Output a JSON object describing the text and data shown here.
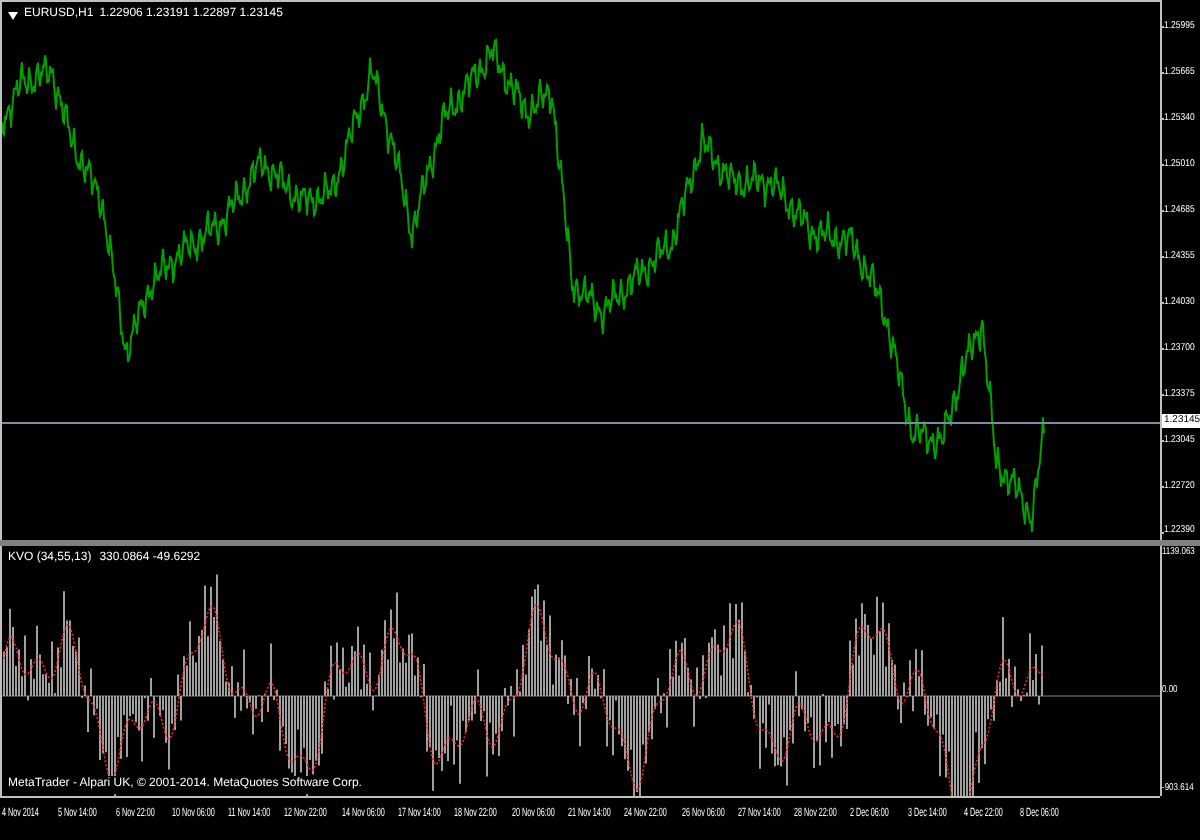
{
  "symbol_header": {
    "text": "EURUSD,H1",
    "quotes": "1.22906 1.23191 1.22897 1.23145"
  },
  "price_axis": {
    "ticks": [
      "1.25995",
      "1.25665",
      "1.25340",
      "1.25010",
      "1.24685",
      "1.24355",
      "1.24030",
      "1.23700",
      "1.23375",
      "1.23045",
      "1.22720",
      "1.22390"
    ],
    "current_price": "1.23145"
  },
  "indicator": {
    "label": "KVO (34,55,13)",
    "values": "330.0864 -49.6292",
    "axis": [
      "1139.063",
      "0.00",
      "-903.614"
    ]
  },
  "copyright": "MetaTrader - Alpari UK, © 2001-2014. MetaQuotes Software Corp.",
  "time_axis": [
    "4 Nov 2014",
    "5 Nov 14:00",
    "6 Nov 22:00",
    "10 Nov 06:00",
    "11 Nov 14:00",
    "12 Nov 22:00",
    "14 Nov 06:00",
    "17 Nov 14:00",
    "18 Nov 22:00",
    "20 Nov 06:00",
    "21 Nov 14:00",
    "24 Nov 22:00",
    "26 Nov 06:00",
    "27 Nov 14:00",
    "28 Nov 22:00",
    "2 Dec 06:00",
    "3 Dec 14:00",
    "4 Dec 22:00",
    "8 Dec 06:00"
  ]
}
